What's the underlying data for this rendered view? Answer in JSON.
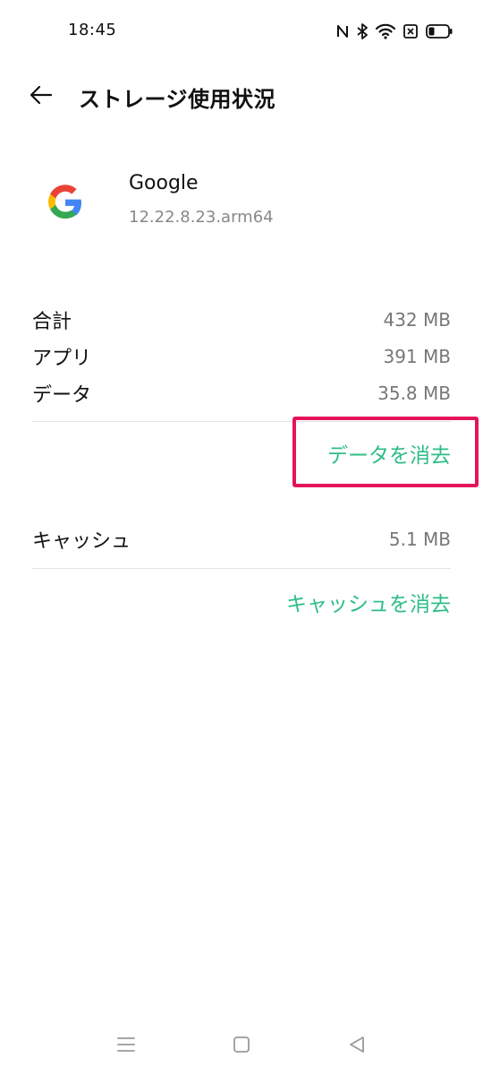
{
  "status_bar": {
    "time": "18:45",
    "icons": [
      "nfc-icon",
      "bluetooth-icon",
      "wifi-icon",
      "no-sim-icon",
      "battery-icon"
    ],
    "battery_level": 0.3
  },
  "header": {
    "title": "ストレージ使用状況",
    "back_icon": "arrow-left-icon"
  },
  "app": {
    "name": "Google",
    "version": "12.22.8.23.arm64",
    "icon": "google-g-logo"
  },
  "storage": {
    "rows": [
      {
        "label": "合計",
        "value": "432 MB"
      },
      {
        "label": "アプリ",
        "value": "391 MB"
      },
      {
        "label": "データ",
        "value": "35.8 MB"
      }
    ],
    "clear_data_label": "データを消去",
    "cache_label": "キャッシュ",
    "cache_value": "5.1 MB",
    "clear_cache_label": "キャッシュを消去"
  },
  "nav": {
    "icons": [
      "menu-icon",
      "home-icon",
      "back-icon"
    ]
  },
  "colors": {
    "accent": "#2ebd85",
    "highlight": "#e4145a",
    "divider": "#e3e3e3"
  }
}
